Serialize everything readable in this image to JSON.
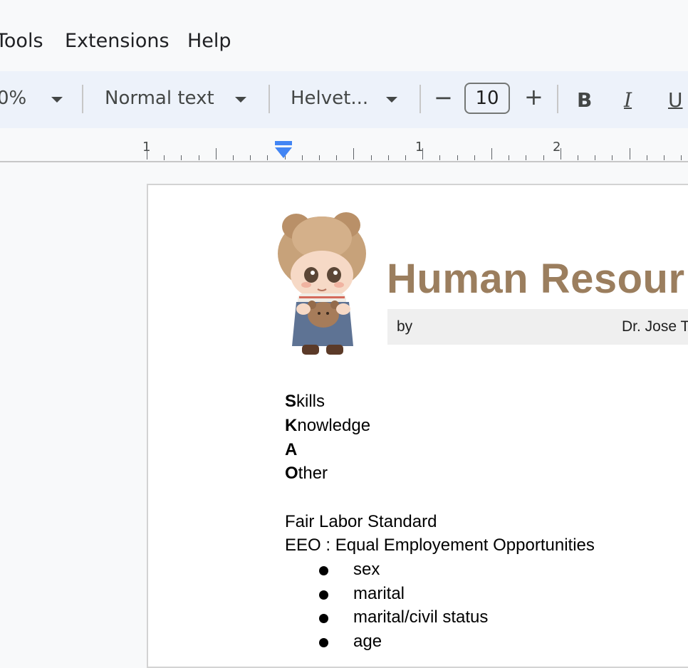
{
  "menu": {
    "items": [
      "Tools",
      "Extensions",
      "Help"
    ]
  },
  "toolbar": {
    "zoom": "0%",
    "style": "Normal text",
    "font": "Helvet...",
    "font_size": "10",
    "decrease": "−",
    "increase": "+",
    "bold": "B",
    "italic": "I",
    "underline": "U"
  },
  "ruler": {
    "labels": [
      "1",
      "1",
      "2"
    ]
  },
  "document": {
    "title": "Human Resour",
    "byline_by": "by",
    "byline_author": "Dr. Jose To",
    "ksao": [
      {
        "initial": "S",
        "rest": "kills"
      },
      {
        "initial": "K",
        "rest": "nowledge"
      },
      {
        "initial": "A",
        "rest": ""
      },
      {
        "initial": "O",
        "rest": "ther"
      }
    ],
    "line_fair_labor": "Fair Labor Standard",
    "line_eeo": "EEO : Equal Employement Opportunities",
    "bullets": [
      "sex",
      "marital",
      "marital/civil status",
      "age"
    ]
  },
  "colors": {
    "title": "#9b7e5e",
    "byline_bg": "#efefef",
    "toolbar_bg": "#edf2fa",
    "indent_marker": "#4285f4"
  }
}
